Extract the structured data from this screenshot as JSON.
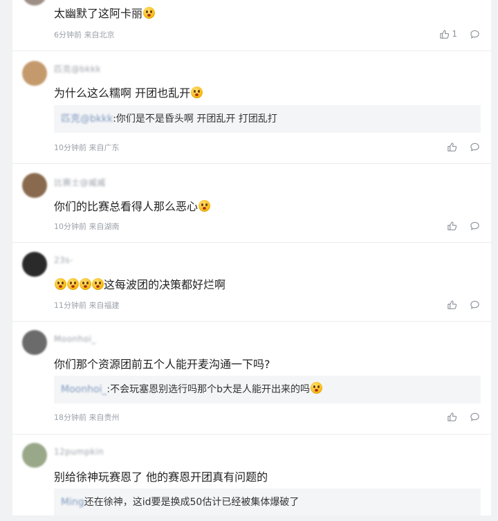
{
  "comments": [
    {
      "username": "",
      "text": "太幽默了这阿卡丽",
      "meta": "6分钟前 来自北京",
      "like_count": "1",
      "avatar_color": "#9d8f86"
    },
    {
      "username": "匹克@bkkk",
      "text": "为什么这么糯啊 开团也乱开",
      "quote": {
        "name": "匹克@bkkk",
        "text": ":你们是不是昏头啊 开团乱开 打团乱打"
      },
      "meta": "10分钟前 来自广东",
      "like_count": "",
      "avatar_color": "#c49a6c"
    },
    {
      "username": "比赛士@威威",
      "text": "你们的比赛总看得人那么恶心",
      "meta": "10分钟前 来自湖南",
      "like_count": "",
      "avatar_color": "#8a6a4e"
    },
    {
      "username": "23s-",
      "text": "这每波团的决策都好烂啊",
      "meta": "11分钟前 来自福建",
      "like_count": "",
      "avatar_color": "#2a2a2a"
    },
    {
      "username": "Moonhoi_",
      "text": "你们那个资源团前五个人能开麦沟通一下吗?",
      "quote": {
        "name": "Moonhoi_",
        "text": ":不会玩塞恩别选行吗那个b大是人能开出来的吗"
      },
      "meta": "18分钟前 来自贵州",
      "like_count": "",
      "avatar_color": "#6b6b6b"
    },
    {
      "username": "12pumpkin",
      "text": "别给徐神玩赛恩了 他的赛恩开团真有问题的",
      "quote": {
        "name": "Ming",
        "text": "还在徐神，这id要是换成50估计已经被集体爆破了"
      },
      "meta": "",
      "like_count": "",
      "avatar_color": "#9aa88a"
    }
  ],
  "colors": {
    "page_bg": "#f1f2f4",
    "card_bg": "#ffffff",
    "meta_text": "#9aa0a8",
    "quote_bg": "#f4f5f7",
    "quote_name": "#7e9ac0"
  },
  "icons": {
    "like": "thumbs-up-icon",
    "reply": "comment-bubble-icon"
  }
}
